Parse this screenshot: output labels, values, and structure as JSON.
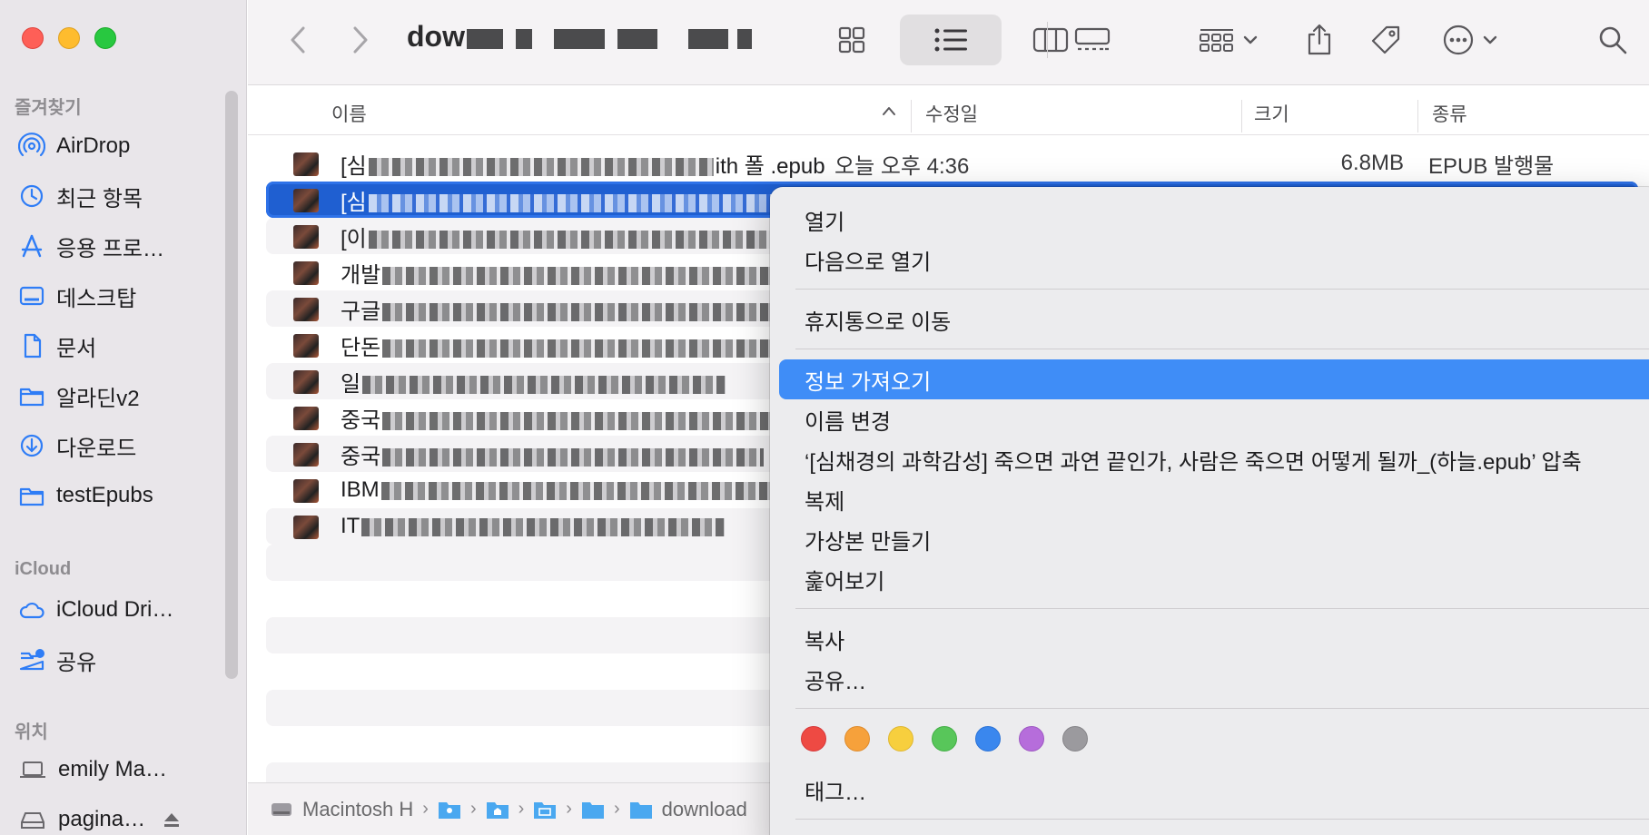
{
  "sidebar": {
    "favorites_label": "즐겨찾기",
    "favorites": [
      {
        "label": "AirDrop",
        "icon": "airdrop-icon"
      },
      {
        "label": "최근 항목",
        "icon": "clock-icon"
      },
      {
        "label": "응용 프로…",
        "icon": "applications-icon"
      },
      {
        "label": "데스크탑",
        "icon": "desktop-icon"
      },
      {
        "label": "문서",
        "icon": "document-icon"
      },
      {
        "label": "알라딘v2",
        "icon": "folder-icon"
      },
      {
        "label": "다운로드",
        "icon": "download-icon"
      },
      {
        "label": "testEpubs",
        "icon": "folder-icon"
      }
    ],
    "icloud_label": "iCloud",
    "icloud": [
      {
        "label": "iCloud Dri…",
        "icon": "cloud-icon"
      },
      {
        "label": "공유",
        "icon": "shared-folder-icon"
      }
    ],
    "locations_label": "위치",
    "locations": [
      {
        "label": "emily Ma…",
        "icon": "laptop-icon"
      },
      {
        "label": "pagina…",
        "icon": "drive-icon"
      }
    ]
  },
  "toolbar": {
    "title": "dow"
  },
  "columns": {
    "name": "이름",
    "modified": "수정일",
    "size": "크기",
    "kind": "종류"
  },
  "files": [
    {
      "name_start": "[심",
      "name_end": "ith 폴 .epub",
      "date": "오늘 오후 4:36",
      "size": "6.8MB",
      "kind": "EPUB 발행물"
    },
    {
      "name_start": "[심",
      "name_end": "",
      "date": "",
      "size": "",
      "kind": ""
    },
    {
      "name_start": "[이",
      "name_end": "",
      "date": "",
      "size": "",
      "kind": ""
    },
    {
      "name_start": "개발",
      "name_end": "",
      "date": "",
      "size": "",
      "kind": ""
    },
    {
      "name_start": "구글",
      "name_end": "",
      "date": "",
      "size": "",
      "kind": ""
    },
    {
      "name_start": "단돈",
      "name_end": "",
      "date": "",
      "size": "",
      "kind": ""
    },
    {
      "name_start": "일",
      "name_end": "",
      "date": "",
      "size": "",
      "kind": ""
    },
    {
      "name_start": "중국",
      "name_end": "",
      "date": "",
      "size": "",
      "kind": ""
    },
    {
      "name_start": "중국",
      "name_end": "",
      "date": "",
      "size": "",
      "kind": ""
    },
    {
      "name_start": "IBM",
      "name_end": "",
      "date": "",
      "size": "",
      "kind": ""
    },
    {
      "name_start": "IT",
      "name_end": "",
      "date": "",
      "size": "",
      "kind": ""
    }
  ],
  "pathbar": {
    "root": "Macintosh H",
    "last": "download"
  },
  "context_menu": {
    "items": [
      {
        "label": "열기"
      },
      {
        "label": "다음으로 열기"
      },
      {
        "label": "휴지통으로 이동"
      },
      {
        "label": "정보 가져오기"
      },
      {
        "label": "이름 변경"
      },
      {
        "label": "‘[심채경의 과학감성] 죽으면 과연 끝인가, 사람은 죽으면 어떻게 될까_(하늘.epub’ 압축"
      },
      {
        "label": "복제"
      },
      {
        "label": "가상본 만들기"
      },
      {
        "label": "훑어보기"
      },
      {
        "label": "복사"
      },
      {
        "label": "공유…"
      },
      {
        "label": "태그…"
      }
    ],
    "highlight_color": "#3f8df7",
    "tag_colors": [
      "#ee4a43",
      "#f6a13b",
      "#f7cf3e",
      "#58c65a",
      "#3a87ee",
      "#b66ddb",
      "#9b9a9e"
    ]
  }
}
